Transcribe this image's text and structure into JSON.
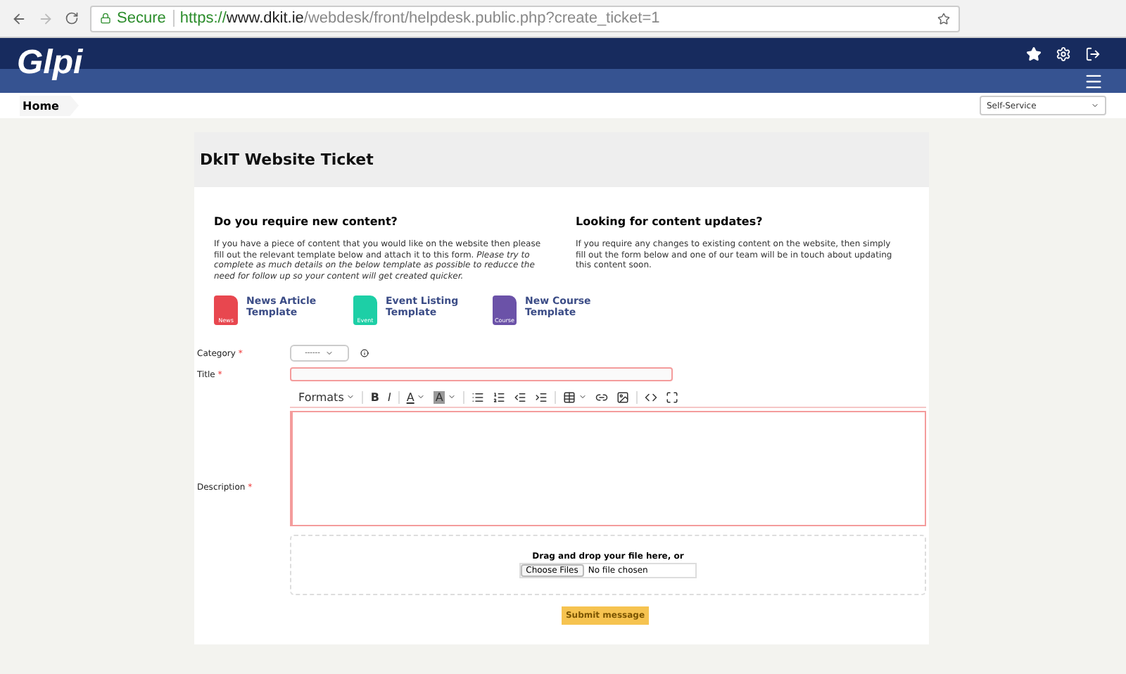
{
  "browser": {
    "secure_label": "Secure",
    "url": {
      "scheme": "https://",
      "host": "www.dkit.ie",
      "path": "/webdesk/front/helpdesk.public.php?create_ticket=1"
    }
  },
  "header": {
    "logo": "Glpi"
  },
  "breadcrumb": {
    "label": "Home"
  },
  "profile_select": {
    "value": "Self-Service"
  },
  "ticket": {
    "title": "DkIT Website Ticket",
    "columns": [
      {
        "heading": "Do you require new content?",
        "text": "If you have a piece of content that you would like on the website then please fill out the relevant template below and attach it to this form. *Please try to complete as much details on the below template as possible to reducce the need for follow up so your content will get created quicker.*"
      },
      {
        "heading": "Looking for content updates?",
        "text": "If you require any changes to existing content on the website, then simply fill out the form below and one of our team will be in touch about updating this content soon."
      }
    ],
    "templates": [
      {
        "label": "News Article Template",
        "tag": "News",
        "color": "#e8474f"
      },
      {
        "label": "Event Listing Template",
        "tag": "Event",
        "color": "#1dcfa6"
      },
      {
        "label": "New Course Template",
        "tag": "Course",
        "color": "#6b52a8"
      }
    ],
    "category": {
      "label": "Category",
      "mark": "*",
      "value": "------"
    },
    "title_field": {
      "label": "Title",
      "mark": "*",
      "invalid": true
    },
    "description": {
      "label": "Description",
      "mark": "*",
      "invalid": true
    },
    "toolbar_groups": [
      {
        "items": [
          {
            "kind": "menu",
            "label": "Formats"
          }
        ]
      },
      {
        "items": [
          {
            "kind": "bold",
            "label": "B"
          },
          {
            "kind": "italic",
            "label": "I"
          }
        ]
      },
      {
        "items": [
          {
            "kind": "textcolor",
            "label": "A"
          },
          {
            "kind": "bgcolor",
            "label": "A"
          }
        ]
      },
      {
        "items": [
          {
            "kind": "bullets"
          },
          {
            "kind": "numbers"
          },
          {
            "kind": "outdent"
          },
          {
            "kind": "indent"
          }
        ]
      },
      {
        "items": [
          {
            "kind": "table"
          },
          {
            "kind": "link"
          },
          {
            "kind": "image"
          }
        ]
      },
      {
        "items": [
          {
            "kind": "code"
          },
          {
            "kind": "fullscreen"
          }
        ]
      }
    ],
    "dropzone": {
      "text": "Drag and drop your file here, or",
      "button": "Choose Files",
      "status": "No file chosen"
    },
    "submit": "Submit message"
  }
}
